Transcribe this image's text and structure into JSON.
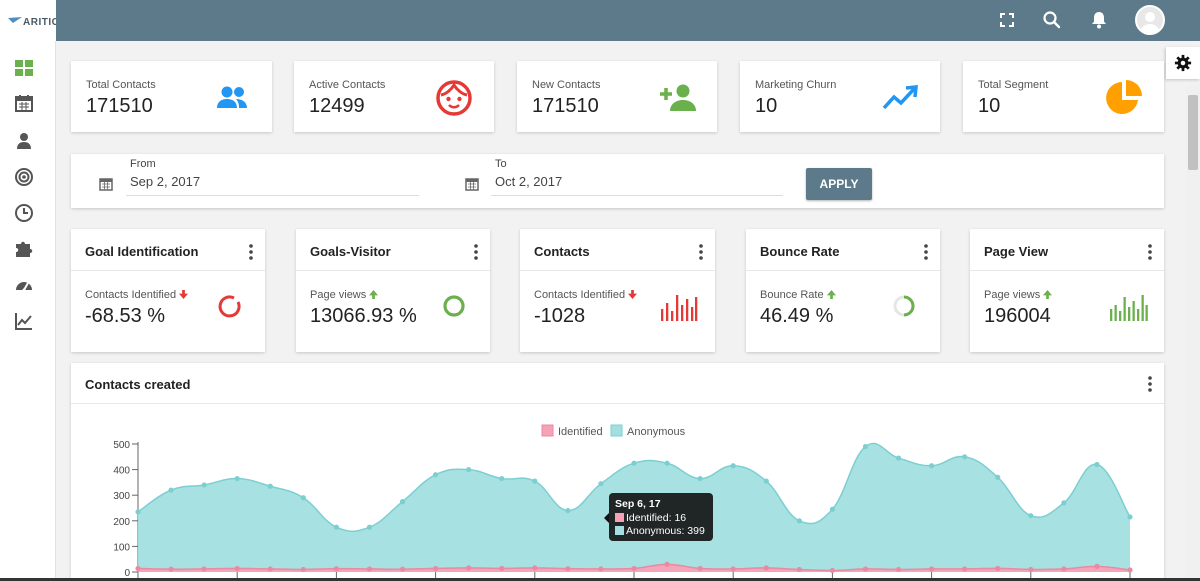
{
  "app": {
    "logo_text": "ARITIC"
  },
  "stats": [
    {
      "label": "Total Contacts",
      "value": "171510",
      "icon": "users-icon",
      "color": "#2196f3"
    },
    {
      "label": "Active Contacts",
      "value": "12499",
      "icon": "smiley-face-icon",
      "color": "#e53935"
    },
    {
      "label": "New Contacts",
      "value": "171510",
      "icon": "add-user-icon",
      "color": "#6ab04c"
    },
    {
      "label": "Marketing Churn",
      "value": "10",
      "icon": "trending-up-icon",
      "color": "#2196f3"
    },
    {
      "label": "Total Segment",
      "value": "10",
      "icon": "pie-chart-icon",
      "color": "#ffa000"
    }
  ],
  "filter": {
    "from_label": "From",
    "from_value": "Sep 2, 2017",
    "to_label": "To",
    "to_value": "Oct 2, 2017",
    "apply_label": "APPLY"
  },
  "kpis": [
    {
      "title": "Goal Identification",
      "sub": "Contacts Identified",
      "trend": "down",
      "value": "-68.53 %",
      "graphic": "donut-red"
    },
    {
      "title": "Goals-Visitor",
      "sub": "Page views",
      "trend": "up",
      "value": "13066.93 %",
      "graphic": "ring-green"
    },
    {
      "title": "Contacts",
      "sub": "Contacts Identified",
      "trend": "down",
      "value": "-1028",
      "graphic": "bars-red"
    },
    {
      "title": "Bounce Rate",
      "sub": "Bounce Rate",
      "trend": "up",
      "value": "46.49 %",
      "graphic": "donut-green"
    },
    {
      "title": "Page View",
      "sub": "Page views",
      "trend": "up",
      "value": "196004",
      "graphic": "bars-green"
    }
  ],
  "colors": {
    "up": "#6ab04c",
    "down": "#e53935",
    "accent": "#5c7a89",
    "anonymous": "#a3dfe0",
    "identified": "#f7a1b6"
  },
  "contacts_chart": {
    "title": "Contacts created",
    "tooltip": {
      "title": "Sep 6, 17",
      "identified": "Identified: 16",
      "anonymous": "Anonymous: 399"
    }
  },
  "chart_data": {
    "type": "area",
    "title": "Contacts created",
    "ylim": [
      0,
      500
    ],
    "yticks": [
      0,
      100,
      200,
      300,
      400,
      500
    ],
    "legend_position": "top-center",
    "series": [
      {
        "name": "Identified",
        "color": "#f7a1b6",
        "values": [
          14,
          11,
          12,
          14,
          12,
          10,
          13,
          12,
          11,
          14,
          16,
          14,
          16,
          13,
          12,
          14,
          30,
          14,
          12,
          16,
          10,
          6,
          12,
          10,
          12,
          12,
          14,
          10,
          12,
          22,
          8
        ]
      },
      {
        "name": "Anonymous",
        "color": "#a3dfe0",
        "values": [
          235,
          320,
          340,
          365,
          335,
          290,
          175,
          175,
          275,
          380,
          400,
          365,
          355,
          240,
          345,
          425,
          425,
          365,
          415,
          355,
          200,
          245,
          490,
          445,
          415,
          450,
          370,
          220,
          270,
          420,
          215
        ]
      }
    ]
  }
}
